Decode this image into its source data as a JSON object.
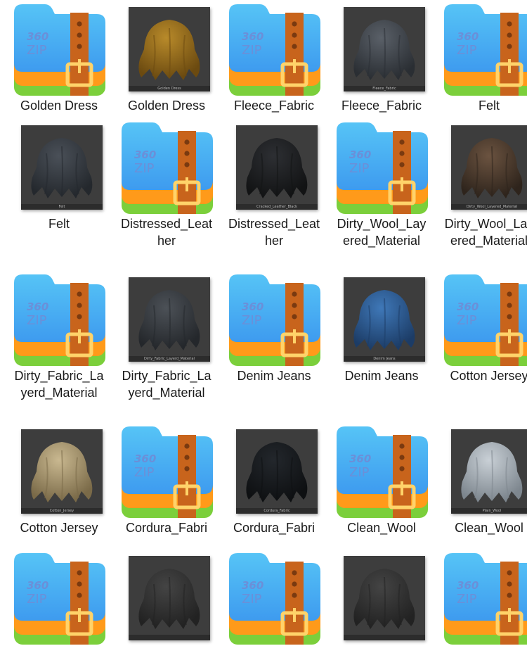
{
  "colors": {
    "zip_blue_top": "#56c4f6",
    "zip_blue_bottom": "#3e9bef",
    "zip_orange": "#ff9a1a",
    "zip_green": "#7bcf3b",
    "zip_strap": "#c8641c",
    "zip_buckle": "#ffd36a",
    "zip_text": "#6b8fd8",
    "thumb_bg": "#3d3d3d"
  },
  "zip_icon": {
    "brand_top": "360",
    "brand_bottom": "ZIP",
    "icon_name": "360zip-archive-icon"
  },
  "items": [
    {
      "kind": "zip",
      "label": "Golden Dress"
    },
    {
      "kind": "thumb",
      "label": "Golden Dress",
      "caption": "Golden Dress",
      "cloth": "#b88a2a",
      "cloth_dark": "#6b4a10"
    },
    {
      "kind": "zip",
      "label": "Fleece_Fabric"
    },
    {
      "kind": "thumb",
      "label": "Fleece_Fabric",
      "caption": "Fleece_Fabric",
      "cloth": "#5a6068",
      "cloth_dark": "#2a2e33"
    },
    {
      "kind": "zip",
      "label": "Felt"
    },
    {
      "kind": "thumb",
      "label": "Felt",
      "caption": "Felt",
      "cloth": "#4a5058",
      "cloth_dark": "#24282d"
    },
    {
      "kind": "zip",
      "label": "Distressed_Leather"
    },
    {
      "kind": "thumb",
      "label": "Distressed_Leather",
      "caption": "Cracked_Leather_Black",
      "cloth": "#2d2f33",
      "cloth_dark": "#121314"
    },
    {
      "kind": "zip",
      "label": "Dirty_Wool_Layered_Material"
    },
    {
      "kind": "thumb",
      "label": "Dirty_Wool_Layered_Material",
      "caption": "Dirty_Wool_Layered_Material",
      "cloth": "#6b5340",
      "cloth_dark": "#2e241c"
    },
    {
      "kind": "zip",
      "label": "Dirty_Fabric_Layerd_Material"
    },
    {
      "kind": "thumb",
      "label": "Dirty_Fabric_Layerd_Material",
      "caption": "Dirty_Fabric_Layerd_Material",
      "cloth": "#4c5157",
      "cloth_dark": "#24272b"
    },
    {
      "kind": "zip",
      "label": "Denim Jeans"
    },
    {
      "kind": "thumb",
      "label": "Denim Jeans",
      "caption": "Denim Jeans",
      "cloth": "#3f78b8",
      "cloth_dark": "#1c3c66"
    },
    {
      "kind": "zip",
      "label": "Cotton Jersey"
    },
    {
      "kind": "thumb",
      "label": "Cotton Jersey",
      "caption": "Cotton_Jersey",
      "cloth": "#c9b890",
      "cloth_dark": "#7a6a48"
    },
    {
      "kind": "zip",
      "label": "Cordura_Fabri"
    },
    {
      "kind": "thumb",
      "label": "Cordura_Fabri",
      "caption": "Cordura_Fabric",
      "cloth": "#23272c",
      "cloth_dark": "#0e1012"
    },
    {
      "kind": "zip",
      "label": "Clean_Wool"
    },
    {
      "kind": "thumb",
      "label": "Clean_Wool",
      "caption": "Plain_Wool",
      "cloth": "#c9d0d6",
      "cloth_dark": "#7d868e"
    },
    {
      "kind": "zip",
      "label": ""
    },
    {
      "kind": "thumb",
      "label": "",
      "caption": "",
      "cloth": "#444444",
      "cloth_dark": "#222222"
    },
    {
      "kind": "zip",
      "label": ""
    },
    {
      "kind": "thumb",
      "label": "",
      "caption": "",
      "cloth": "#444444",
      "cloth_dark": "#222222"
    },
    {
      "kind": "zip",
      "label": ""
    }
  ]
}
